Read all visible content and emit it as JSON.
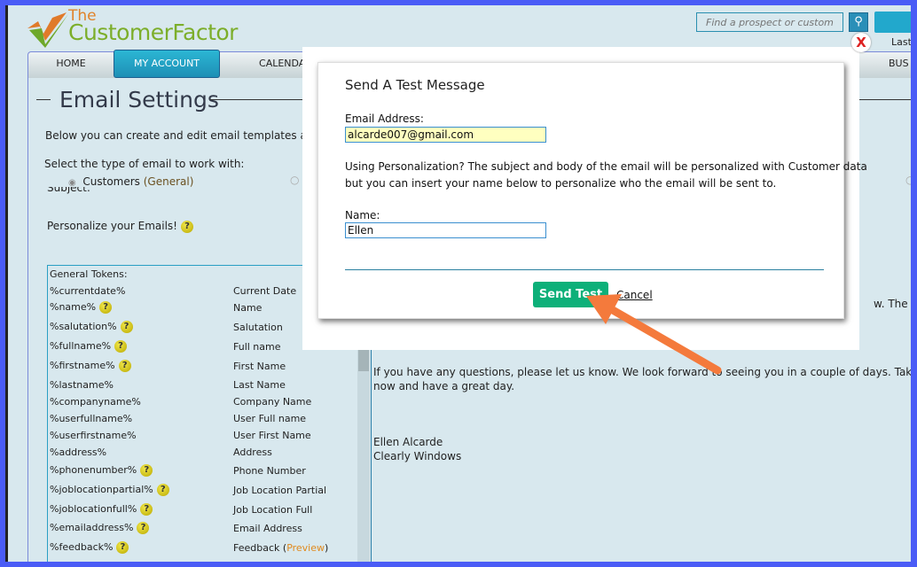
{
  "logo": {
    "line1": "The",
    "line2": "CustomerFactor"
  },
  "header": {
    "search_placeholder": "Find a prospect or customer",
    "last_visit": "Last v"
  },
  "nav": {
    "items": [
      "HOME",
      "MY ACCOUNT",
      "CALENDAR",
      "BUS"
    ],
    "active": "MY ACCOUNT"
  },
  "page": {
    "title": "Email Settings",
    "intro": "Below you can create and edit email templates and/or",
    "select_label": "Select the type of email to work with:",
    "radio_customers": "Customers",
    "radio_customers_sub": "(General)",
    "subject_label": "Subject:",
    "personalize": "Personalize your Emails!"
  },
  "tokens": {
    "header": "General Tokens:",
    "rows": [
      {
        "token": "%currentdate%",
        "desc": "Current Date",
        "help": false
      },
      {
        "token": "%name%",
        "desc": "Name",
        "help": true
      },
      {
        "token": "%salutation%",
        "desc": "Salutation",
        "help": true
      },
      {
        "token": "%fullname%",
        "desc": "Full name",
        "help": true
      },
      {
        "token": "%firstname%",
        "desc": "First Name",
        "help": true
      },
      {
        "token": "%lastname%",
        "desc": "Last Name",
        "help": false
      },
      {
        "token": "%companyname%",
        "desc": "Company Name",
        "help": false
      },
      {
        "token": "%userfullname%",
        "desc": "User Full name",
        "help": false
      },
      {
        "token": "%userfirstname%",
        "desc": "User First Name",
        "help": false
      },
      {
        "token": "%address%",
        "desc": "Address",
        "help": false
      },
      {
        "token": "%phonenumber%",
        "desc": "Phone Number",
        "help": true
      },
      {
        "token": "%joblocationpartial%",
        "desc": "Job Location Partial",
        "help": true
      },
      {
        "token": "%joblocationfull%",
        "desc": "Job Location Full",
        "help": true
      },
      {
        "token": "%emailaddress%",
        "desc": "Email Address",
        "help": true
      },
      {
        "token": "%feedback%",
        "desc": "Feedback",
        "help": true
      }
    ],
    "preview_label": "Preview"
  },
  "email_body": {
    "fragment": "w. The",
    "para": "If you have any questions, please let us know. We look forward to seeing you in a couple of days. Take care for",
    "para2": "now and have a great day.",
    "sig1": "Ellen Alcarde",
    "sig2": "Clearly Windows"
  },
  "dialog": {
    "title": "Send A Test Message",
    "email_label": "Email Address:",
    "email_value": "alcarde007@gmail.com",
    "personalization_bold": "Using Personalization?",
    "personalization_text": " The subject and body of the email will be personalized with Customer data",
    "personalization_text2": "but you can insert your name below to personalize who the email will be sent to.",
    "name_label": "Name:",
    "name_value": "Ellen",
    "send_label": "Send Test",
    "cancel_label": "Cancel"
  },
  "colors": {
    "send_button": "#0db079",
    "arrow": "#f47a3c",
    "frame": "#4a5cf6",
    "page_bg": "#d8e8ee"
  }
}
